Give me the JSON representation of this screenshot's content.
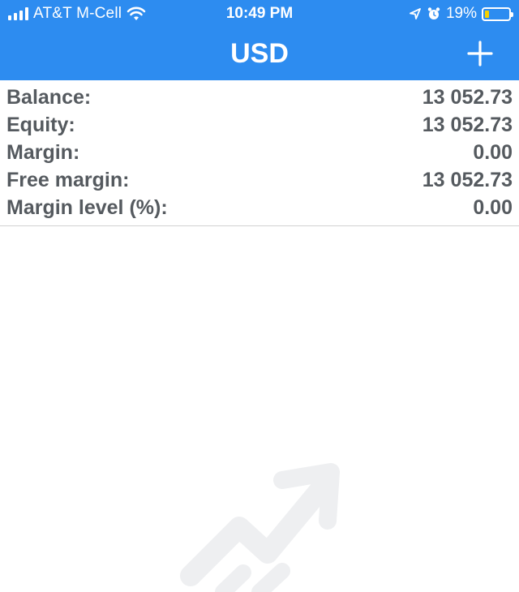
{
  "status_bar": {
    "carrier": "AT&T M-Cell",
    "time": "10:49 PM",
    "battery_percent": "19%",
    "battery_level": 0.19,
    "icons": [
      "signal-icon",
      "wifi-icon",
      "location-icon",
      "alarm-icon",
      "battery-icon"
    ]
  },
  "header": {
    "title": "USD",
    "add_icon": "plus-icon"
  },
  "account": {
    "rows": [
      {
        "label": "Balance:",
        "value": "13 052.73"
      },
      {
        "label": "Equity:",
        "value": "13 052.73"
      },
      {
        "label": "Margin:",
        "value": "0.00"
      },
      {
        "label": "Free margin:",
        "value": "13 052.73"
      },
      {
        "label": "Margin level (%):",
        "value": "0.00"
      }
    ]
  },
  "colors": {
    "header_bg": "#2d8cf0",
    "row_text": "#555a5f",
    "battery_fill": "#f5d000",
    "watermark": "#eeeff1"
  },
  "watermark_icon": "trend-arrow-icon"
}
